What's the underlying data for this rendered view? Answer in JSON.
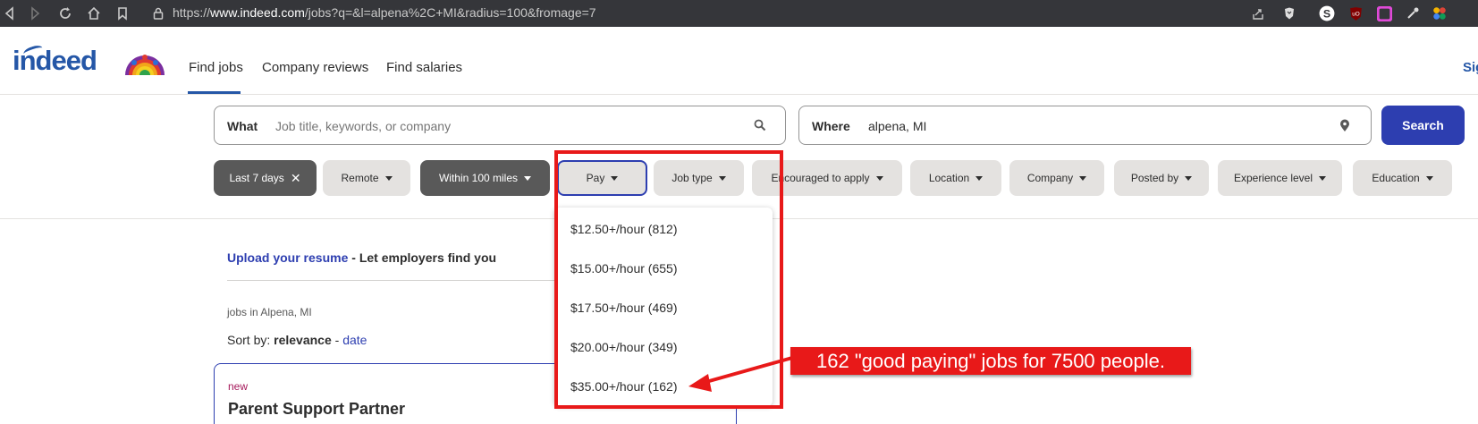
{
  "browser": {
    "url_prefix": "https://",
    "url_domain": "www.indeed.com",
    "url_path": "/jobs?q=&l=alpena%2C+MI&radius=100&fromage=7"
  },
  "header": {
    "logo_text": "indeed",
    "nav": [
      "Find jobs",
      "Company reviews",
      "Find salaries"
    ],
    "signin": "Sig"
  },
  "search": {
    "what_label": "What",
    "what_placeholder": "Job title, keywords, or company",
    "where_label": "Where",
    "where_value": "alpena, MI",
    "button": "Search"
  },
  "filters": [
    {
      "label": "Last 7 days",
      "active": true,
      "close": "✕"
    },
    {
      "label": "Remote"
    },
    {
      "label": "Within 100 miles",
      "active": true
    },
    {
      "label": "Pay"
    },
    {
      "label": "Job type"
    },
    {
      "label": "Encouraged to apply"
    },
    {
      "label": "Location"
    },
    {
      "label": "Company"
    },
    {
      "label": "Posted by"
    },
    {
      "label": "Experience level"
    },
    {
      "label": "Education"
    }
  ],
  "pay_options": [
    "$12.50+/hour (812)",
    "$15.00+/hour (655)",
    "$17.50+/hour (469)",
    "$20.00+/hour (349)",
    "$35.00+/hour (162)"
  ],
  "content": {
    "upload_link": "Upload your resume",
    "upload_rest": " - Let employers find you",
    "jobs_in": "jobs in Alpena, MI",
    "sort_label": "Sort by: ",
    "sort_relevance": "relevance",
    "sort_sep": " - ",
    "sort_date": "date",
    "job_badge": "new",
    "job_title": "Parent Support Partner"
  },
  "annotation": {
    "text": "162 \"good paying\" jobs for 7500 people.",
    "color": "#e81919"
  },
  "colors": {
    "brand_blue": "#2557a7",
    "search_button": "#2d3eb0",
    "chip_active": "#595959",
    "chip_default": "#e4e2e0"
  }
}
